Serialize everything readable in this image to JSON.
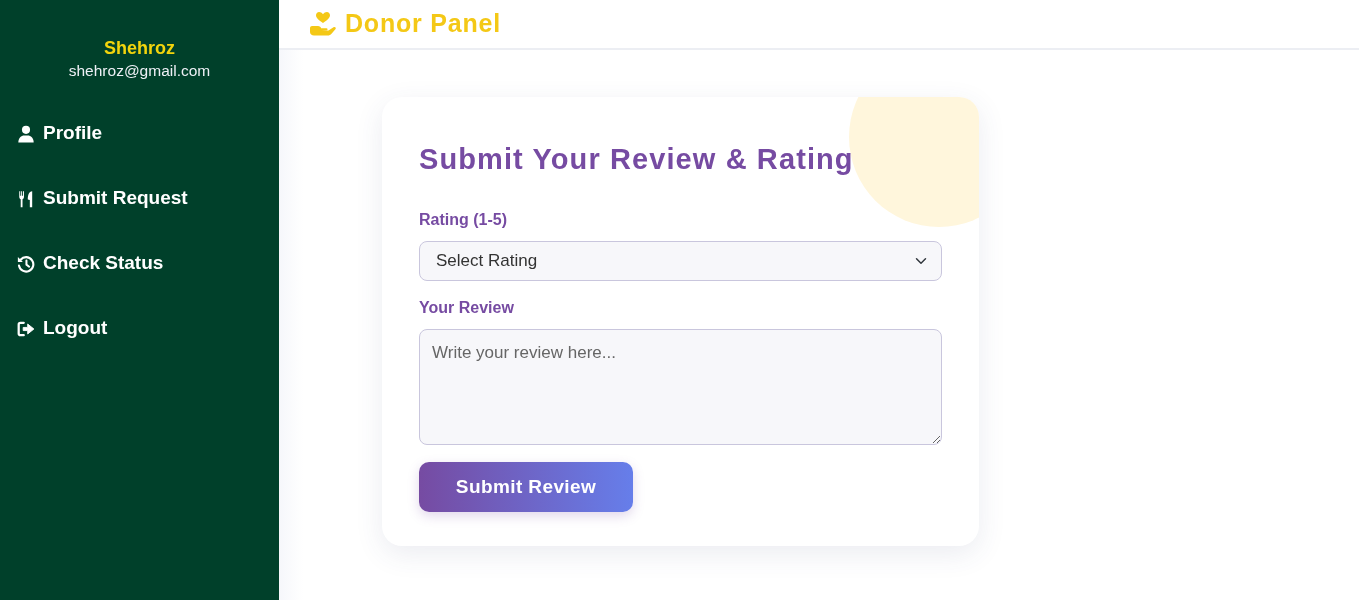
{
  "sidebar": {
    "user_name": "Shehroz",
    "user_email": "shehroz@gmail.com",
    "items": [
      {
        "label": "Profile",
        "selected": false
      },
      {
        "label": "Submit Request",
        "selected": false
      },
      {
        "label": "Check Status",
        "selected": false
      },
      {
        "label": "Logout",
        "selected": false
      }
    ]
  },
  "header": {
    "title": "Donor Panel"
  },
  "review_form": {
    "title": "Submit Your Review & Rating",
    "rating_field": {
      "label": "Rating (1-5)",
      "value": "Select Rating"
    },
    "review_field": {
      "label": "Your Review",
      "placeholder": "Write your review here..."
    },
    "submit_button": "Submit Review"
  }
}
